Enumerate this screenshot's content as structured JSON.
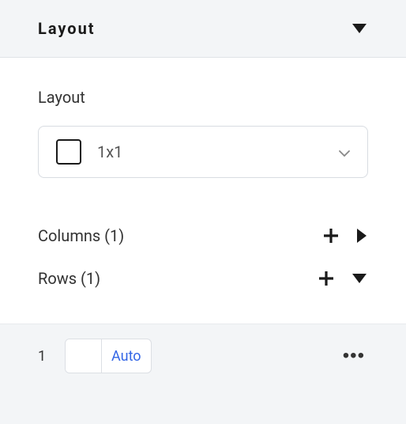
{
  "panel": {
    "title": "Layout"
  },
  "layout": {
    "label": "Layout",
    "selector_value": "1x1"
  },
  "columns": {
    "label": "Columns (1)"
  },
  "rows": {
    "label": "Rows (1)",
    "items": [
      {
        "index": "1",
        "mode_label": "Auto"
      }
    ]
  }
}
